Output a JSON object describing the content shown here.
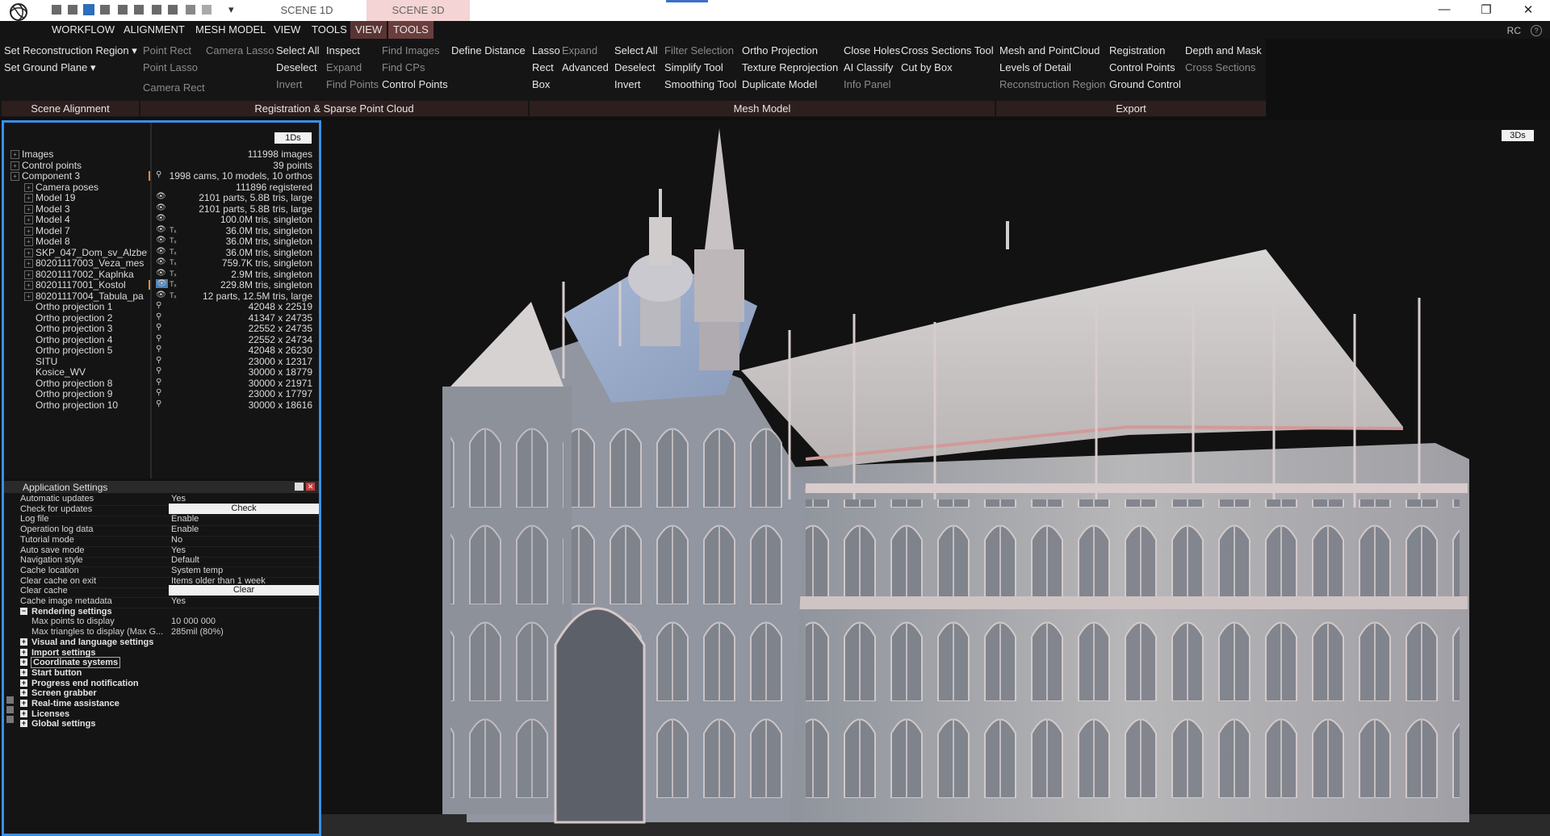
{
  "titlebar": {
    "scene_1d": "SCENE 1D",
    "scene_3d": "SCENE 3D",
    "quick_access": "▾",
    "minimize": "—",
    "maximize": "❐",
    "close": "✕"
  },
  "menu": {
    "workflow": "WORKFLOW",
    "alignment": "ALIGNMENT",
    "mesh_model": "MESH MODEL",
    "view": "VIEW",
    "tools": "TOOLS",
    "view_active": "VIEW",
    "tools_active": "TOOLS",
    "rc": "RC"
  },
  "ribbon": {
    "set_reconstruction_region": "Set Reconstruction Region",
    "set_ground_plane": "Set Ground Plane",
    "point_rect": "Point Rect",
    "camera_lasso": "Camera Lasso",
    "point_lasso": "Point Lasso",
    "camera_rect": "Camera Rect",
    "select_all_1": "Select All",
    "deselect_1": "Deselect",
    "invert_1": "Invert",
    "inspect": "Inspect",
    "expand_1": "Expand",
    "find_points": "Find Points",
    "find_images": "Find Images",
    "find_cps": "Find CPs",
    "control_points_1": "Control Points",
    "define_distance": "Define Distance",
    "lasso": "Lasso",
    "rect": "Rect",
    "box": "Box",
    "expand_2": "Expand",
    "advanced": "Advanced",
    "select_all_2": "Select All",
    "deselect_2": "Deselect",
    "invert_2": "Invert",
    "filter_selection": "Filter Selection",
    "simplify_tool": "Simplify Tool",
    "smoothing_tool": "Smoothing Tool",
    "ortho_projection": "Ortho Projection",
    "texture_reprojection": "Texture Reprojection",
    "duplicate_model": "Duplicate Model",
    "close_holes": "Close Holes",
    "ai_classify": "AI Classify",
    "info_panel": "Info Panel",
    "cross_sections_tool": "Cross Sections Tool",
    "cut_by_box": "Cut by Box",
    "mesh_and_pointcloud": "Mesh and PointCloud",
    "levels_of_detail": "Levels of Detail",
    "reconstruction_region": "Reconstruction Region",
    "registration": "Registration",
    "control_points_2": "Control Points",
    "ground_control": "Ground Control",
    "depth_and_mask": "Depth and Mask",
    "cross_sections": "Cross Sections",
    "sections": {
      "scene_alignment": "Scene Alignment",
      "registration_sparse": "Registration & Sparse Point Cloud",
      "mesh_model": "Mesh Model",
      "export": "Export"
    }
  },
  "panel1d": {
    "tab": "1Ds",
    "tree": [
      {
        "name": "Images",
        "value": "111998 images",
        "indent": 0,
        "icon": ""
      },
      {
        "name": "Control points",
        "value": "39 points",
        "indent": 0,
        "icon": ""
      },
      {
        "name": "Component 3",
        "value": "1998 cams, 10 models, 10 orthos",
        "indent": 0,
        "icon": "pin",
        "mark": true
      },
      {
        "name": "Camera poses",
        "value": "111896 registered",
        "indent": 1,
        "icon": ""
      },
      {
        "name": "Model 19",
        "value": "2101 parts, 5.8B tris, large",
        "indent": 1,
        "icon": "eye"
      },
      {
        "name": "Model 3",
        "value": "2101 parts, 5.8B tris, large",
        "indent": 1,
        "icon": "eye"
      },
      {
        "name": "Model 4",
        "value": "100.0M tris, singleton",
        "indent": 1,
        "icon": "eye"
      },
      {
        "name": "Model 7",
        "value": "36.0M tris, singleton",
        "indent": 1,
        "icon": "eye",
        "tx": true
      },
      {
        "name": "Model 8",
        "value": "36.0M tris, singleton",
        "indent": 1,
        "icon": "eye",
        "tx": true
      },
      {
        "name": "SKP_047_Dom_sv_Alzbet",
        "value": "36.0M tris, singleton",
        "indent": 1,
        "icon": "eye",
        "tx": true
      },
      {
        "name": "80201117003_Veza_mes",
        "value": "759.7K tris, singleton",
        "indent": 1,
        "icon": "eye",
        "tx": true
      },
      {
        "name": "80201117002_Kaplnka",
        "value": "2.9M tris, singleton",
        "indent": 1,
        "icon": "eye",
        "tx": true
      },
      {
        "name": "80201117001_Kostol",
        "value": "229.8M tris, singleton",
        "indent": 1,
        "icon": "eye-active",
        "tx": true,
        "mark": true
      },
      {
        "name": "80201117004_Tabula_pa",
        "value": "12 parts, 12.5M tris, large",
        "indent": 1,
        "icon": "eye",
        "tx": true
      },
      {
        "name": "Ortho projection 1",
        "value": "42048 x 22519",
        "indent": 1,
        "icon": "pin",
        "noexp": true
      },
      {
        "name": "Ortho projection 2",
        "value": "41347 x 24735",
        "indent": 1,
        "icon": "pin",
        "noexp": true
      },
      {
        "name": "Ortho projection 3",
        "value": "22552 x 24735",
        "indent": 1,
        "icon": "pin",
        "noexp": true
      },
      {
        "name": "Ortho projection 4",
        "value": "22552 x 24734",
        "indent": 1,
        "icon": "pin",
        "noexp": true
      },
      {
        "name": "Ortho projection 5",
        "value": "42048 x 26230",
        "indent": 1,
        "icon": "pin",
        "noexp": true
      },
      {
        "name": "SITU",
        "value": "23000 x 12317",
        "indent": 1,
        "icon": "pin",
        "noexp": true
      },
      {
        "name": "Kosice_WV",
        "value": "30000 x 18779",
        "indent": 1,
        "icon": "pin",
        "noexp": true
      },
      {
        "name": "Ortho projection 8",
        "value": "30000 x 21971",
        "indent": 1,
        "icon": "pin",
        "noexp": true
      },
      {
        "name": "Ortho projection 9",
        "value": "23000 x 17797",
        "indent": 1,
        "icon": "pin",
        "noexp": true
      },
      {
        "name": "Ortho projection 10",
        "value": "30000 x 18616",
        "indent": 1,
        "icon": "pin",
        "noexp": true
      }
    ]
  },
  "settings": {
    "title": "Application Settings",
    "rows": [
      {
        "key": "Automatic updates",
        "value": "Yes"
      },
      {
        "key": "Check for updates",
        "button": "Check"
      },
      {
        "key": "Log file",
        "value": "Enable"
      },
      {
        "key": "Operation log data",
        "value": "Enable"
      },
      {
        "key": "Tutorial mode",
        "value": "No"
      },
      {
        "key": "Auto save mode",
        "value": "Yes"
      },
      {
        "key": "Navigation style",
        "value": "Default"
      },
      {
        "key": "Cache location",
        "value": "System temp"
      },
      {
        "key": "Clear cache on exit",
        "value": "Items older than 1 week"
      },
      {
        "key": "Clear cache",
        "button": "Clear"
      },
      {
        "key": "Cache image metadata",
        "value": "Yes"
      }
    ],
    "rendering": {
      "label": "Rendering settings",
      "rows": [
        {
          "key": "Max points to display",
          "value": "10 000 000"
        },
        {
          "key": "Max triangles to display (Max G...",
          "value": "285mil (80%)"
        }
      ]
    },
    "groups": [
      "Visual and language settings",
      "Import settings",
      "Coordinate systems",
      "Start button",
      "Progress end notification",
      "Screen grabber",
      "Real-time assistance",
      "Licenses",
      "Global settings"
    ]
  },
  "viewport": {
    "tab": "3Ds"
  },
  "colors": {
    "accent_blue": "#3a8ee6",
    "tab_active": "#6b3d3d",
    "section_bar": "#2e1f1f"
  }
}
